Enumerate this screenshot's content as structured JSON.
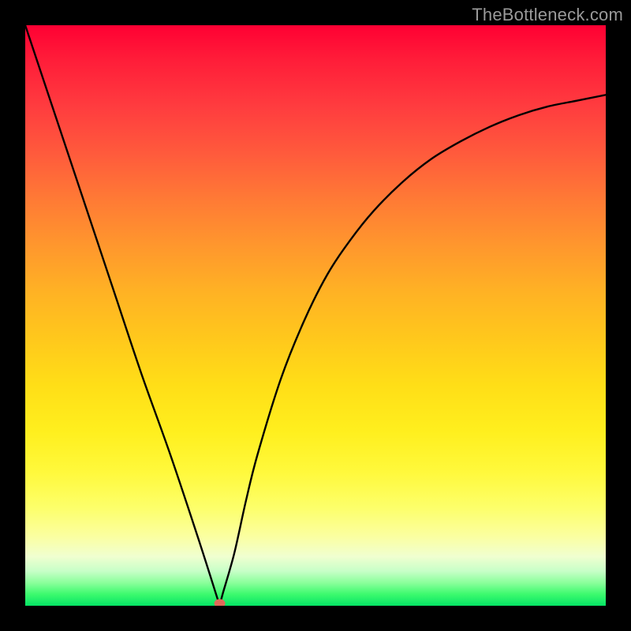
{
  "watermark": "TheBottleneck.com",
  "chart_data": {
    "type": "line",
    "title": "",
    "xlabel": "",
    "ylabel": "",
    "xlim": [
      0,
      100
    ],
    "ylim": [
      0,
      100
    ],
    "background_gradient": {
      "stops": [
        {
          "pos": 0.0,
          "color": "#ff0033"
        },
        {
          "pos": 0.5,
          "color": "#ffb722"
        },
        {
          "pos": 0.8,
          "color": "#fff84c"
        },
        {
          "pos": 0.95,
          "color": "#aaffb4"
        },
        {
          "pos": 1.0,
          "color": "#05e465"
        }
      ]
    },
    "marker": {
      "x": 33.5,
      "y": 0,
      "color": "#e06a5a"
    },
    "series": [
      {
        "name": "curve",
        "x": [
          0,
          5,
          10,
          15,
          20,
          25,
          30,
          33.5,
          34,
          36,
          38,
          40,
          44,
          48,
          52,
          56,
          60,
          65,
          70,
          75,
          80,
          85,
          90,
          95,
          100
        ],
        "values": [
          100,
          85,
          70,
          55,
          40,
          26,
          11,
          0,
          2,
          9,
          18,
          26,
          39,
          49,
          57,
          63,
          68,
          73,
          77,
          80,
          82.5,
          84.5,
          86,
          87,
          88
        ]
      }
    ]
  }
}
